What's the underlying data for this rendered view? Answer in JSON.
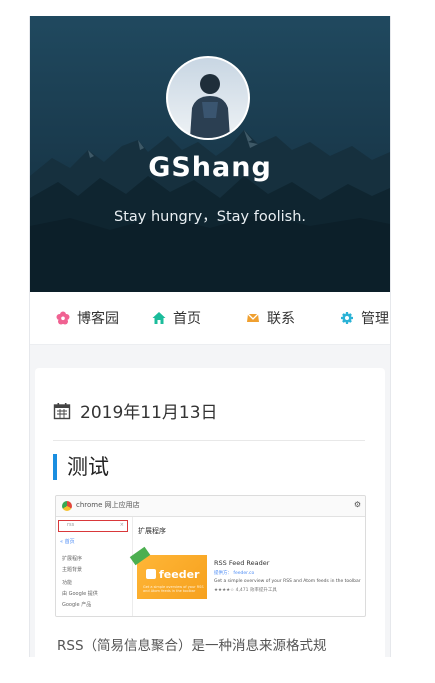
{
  "header": {
    "site_title": "GShang",
    "motto": "Stay hungry，Stay foolish."
  },
  "nav": [
    {
      "label": "博客园",
      "icon": "flower-icon",
      "color": "#f06292"
    },
    {
      "label": "首页",
      "icon": "home-icon",
      "color": "#1bbc9b"
    },
    {
      "label": "联系",
      "icon": "contact-icon",
      "color": "#f0a030"
    },
    {
      "label": "管理",
      "icon": "gear-icon",
      "color": "#2ab2d6"
    }
  ],
  "post": {
    "date": "2019年11月13日",
    "title": "测试",
    "excerpt": "RSS（简易信息聚合）是一种消息来源格式规",
    "screenshot": {
      "topbar_title": "chrome 网上应用店",
      "search_value": "rss",
      "side_back": "« 首页",
      "side_rows": [
        "扩展程序",
        "主题背景",
        "功能",
        "由 Google 提供",
        "Google 产品"
      ],
      "section_title": "扩展程序",
      "tile_name": "feeder",
      "tile_sub": "Get a simple overview of your RSS and Atom feeds in the toolbar",
      "ext_name": "RSS Feed Reader",
      "ext_meta": "提供方： feeder.co",
      "ext_desc": "Get a simple overview of your RSS and Atom feeds in the toolbar",
      "ext_rating": "★★★★☆ 4,471  效率提升工具"
    }
  },
  "colors": {
    "header_bg": "#1a3b4e",
    "accent_bar": "#1a8ee0"
  }
}
